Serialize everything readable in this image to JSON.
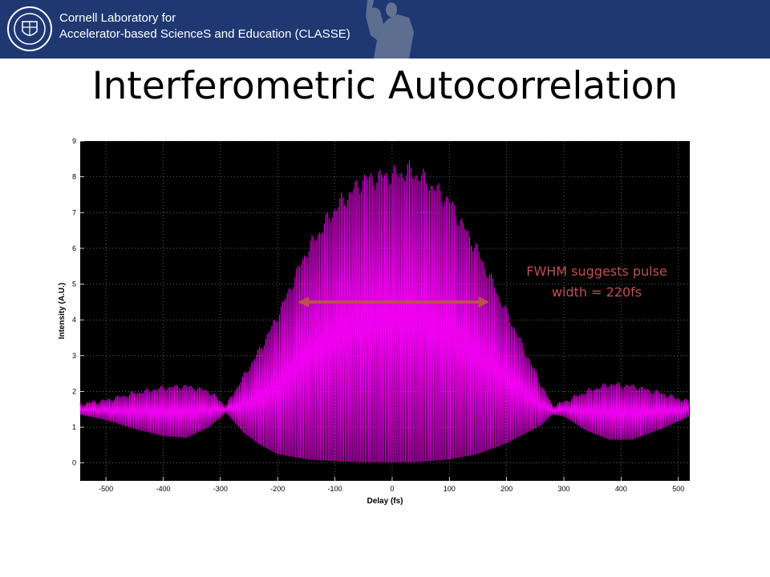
{
  "header": {
    "line1": "Cornell Laboratory for",
    "line2": "Accelerator-based ScienceS and Education (CLASSE)",
    "bg_color": "#1f3872",
    "logo_icon": "cornell-seal-icon",
    "statue_icon": "statue-silhouette-icon"
  },
  "slide": {
    "title": "Interferometric Autocorrelation"
  },
  "annotation": {
    "line1": "FWHM suggests pulse",
    "line2": "width = 220fs",
    "color": "#c0504d"
  },
  "chart_data": {
    "type": "line",
    "xlabel": "Delay (fs)",
    "ylabel": "Intensity (A.U.)",
    "xlim": [
      -545,
      520
    ],
    "ylim": [
      -0.5,
      9
    ],
    "xticks": [
      -500,
      -400,
      -300,
      -200,
      -100,
      0,
      100,
      200,
      300,
      400,
      500
    ],
    "yticks": [
      0,
      1,
      2,
      3,
      4,
      5,
      6,
      7,
      8,
      9
    ],
    "grid": "dotted",
    "background": "#000000",
    "series_color": "#ff00ff",
    "baseline": 1.5,
    "fringe_period_fs": 2.7,
    "envelope": {
      "x": [
        -545,
        -500,
        -450,
        -400,
        -360,
        -320,
        -290,
        -260,
        -230,
        -200,
        -150,
        -100,
        -50,
        0,
        30,
        50,
        100,
        150,
        200,
        230,
        260,
        280,
        300,
        340,
        380,
        420,
        470,
        520
      ],
      "upper": [
        1.65,
        1.75,
        1.95,
        2.1,
        2.15,
        2.0,
        1.6,
        2.4,
        3.2,
        4.1,
        5.9,
        7.1,
        7.9,
        8.05,
        8.15,
        8.0,
        7.3,
        5.9,
        4.2,
        3.2,
        2.2,
        1.6,
        1.7,
        2.0,
        2.2,
        2.15,
        1.95,
        1.7
      ],
      "lower": [
        1.35,
        1.2,
        0.95,
        0.75,
        0.7,
        1.0,
        1.4,
        0.85,
        0.5,
        0.25,
        0.1,
        0.05,
        0.02,
        0.02,
        0.02,
        0.03,
        0.1,
        0.25,
        0.55,
        0.8,
        1.05,
        1.35,
        1.3,
        0.9,
        0.65,
        0.65,
        0.95,
        1.3
      ]
    },
    "fwhm_arrow": {
      "x": [
        -165,
        170
      ],
      "y": 4.5,
      "color": "#c0504d"
    }
  }
}
